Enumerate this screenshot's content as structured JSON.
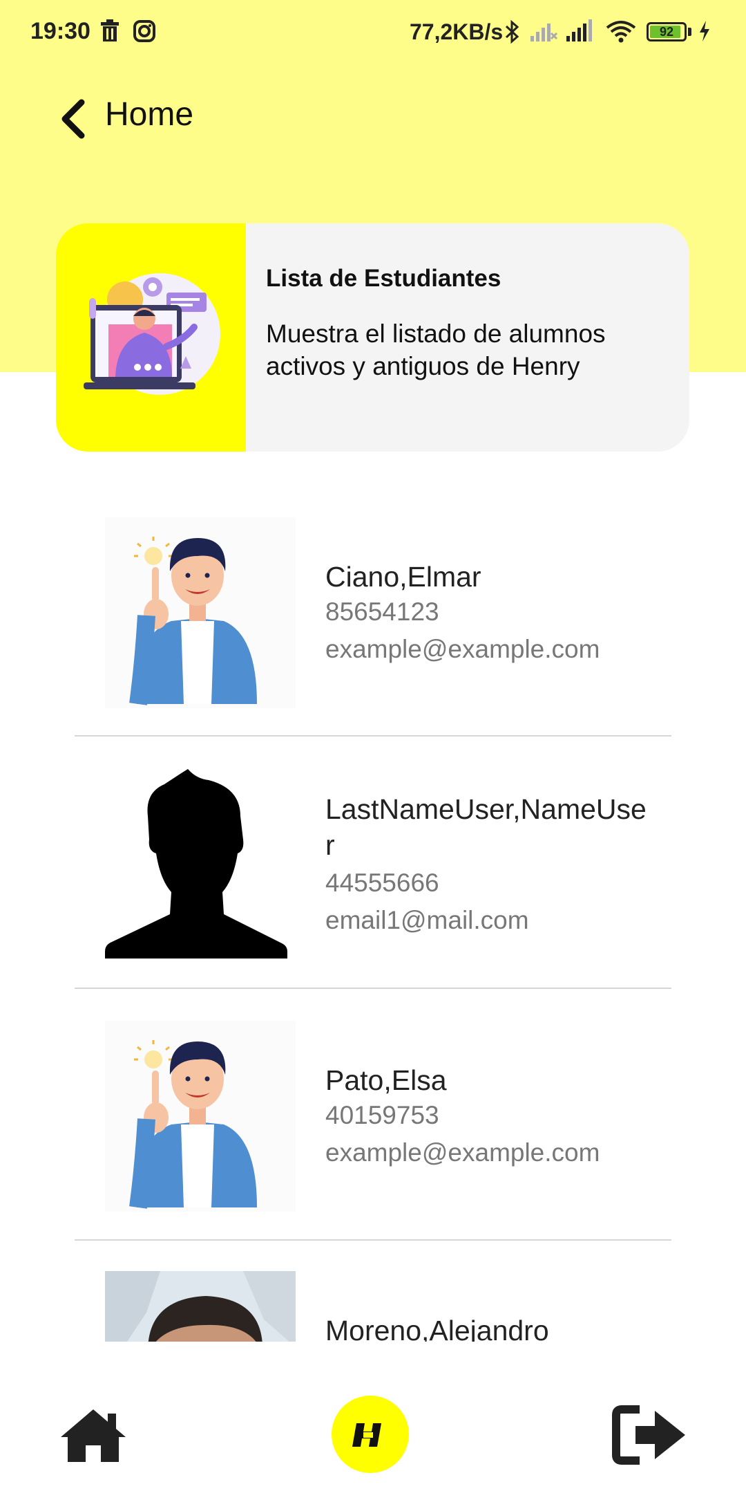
{
  "status_bar": {
    "time": "19:30",
    "network_speed": "77,2KB/s",
    "battery_level": "92",
    "battery_fraction": 0.92,
    "icons": [
      "trash-icon",
      "instagram-icon",
      "bluetooth-icon",
      "signal-weak-icon",
      "signal-icon",
      "wifi-icon",
      "battery-icon",
      "charging-icon"
    ]
  },
  "header": {
    "title": "Home",
    "back_icon": "chevron-left-icon"
  },
  "info_card": {
    "title": "Lista de Estudiantes",
    "description": "Muestra el listado de alumnos activos y antiguos de Henry",
    "image_bg_color": "#ffff00"
  },
  "students": [
    {
      "name": "Ciano,Elmar",
      "dni": "85654123",
      "email": "example@example.com",
      "avatar": "cartoon-man-avatar"
    },
    {
      "name": "LastNameUser,NameUser",
      "dni": "44555666",
      "email": "email1@mail.com",
      "avatar": "silhouette-avatar"
    },
    {
      "name": "Pato,Elsa",
      "dni": "40159753",
      "email": "example@example.com",
      "avatar": "cartoon-man-avatar"
    },
    {
      "name": "Moreno,Alejandro",
      "dni": "",
      "email": "",
      "avatar": "photo-avatar"
    }
  ],
  "bottom_nav": {
    "items": [
      "home-icon",
      "henry-logo-icon",
      "logout-icon"
    ],
    "accent_color": "#ffff00"
  },
  "colors": {
    "header_bg": "#fffd8a",
    "card_bg": "#f4f4f4",
    "secondary_text": "#777777"
  }
}
